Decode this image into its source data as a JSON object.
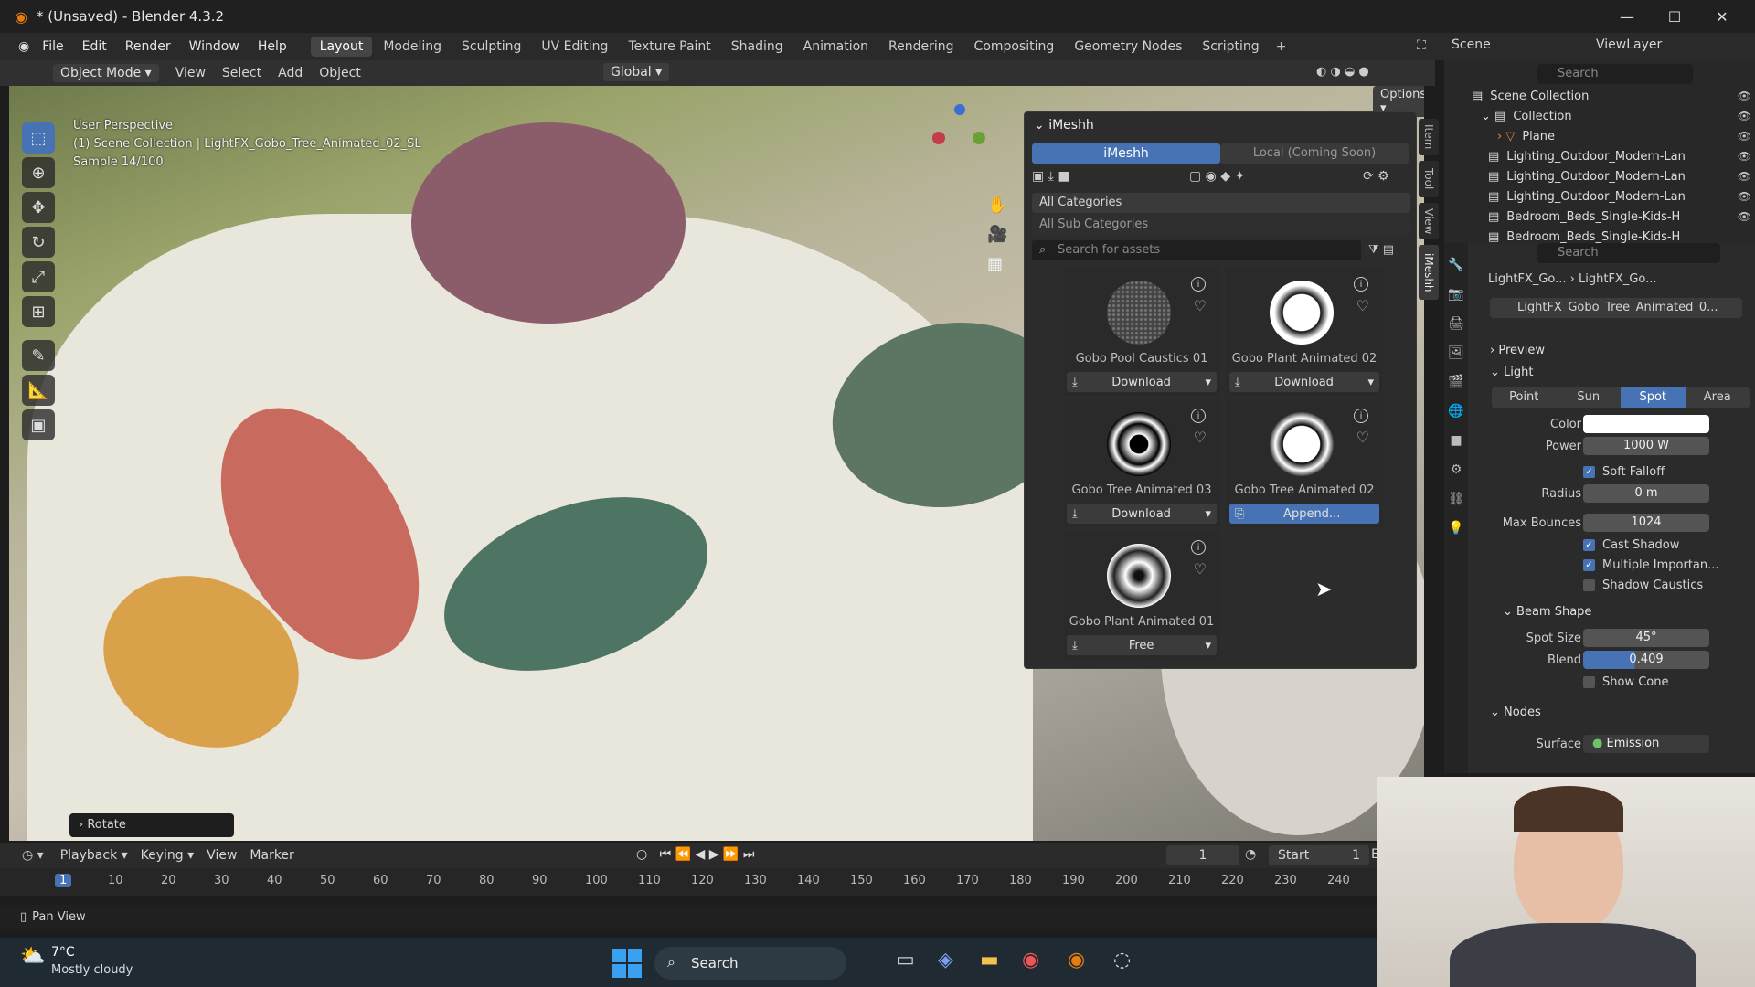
{
  "title": {
    "text": "* (Unsaved) - Blender 4.3.2"
  },
  "menu": {
    "items": [
      "File",
      "Edit",
      "Render",
      "Window",
      "Help"
    ],
    "workspaces": [
      "Layout",
      "Modeling",
      "Sculpting",
      "UV Editing",
      "Texture Paint",
      "Shading",
      "Animation",
      "Rendering",
      "Compositing",
      "Geometry Nodes",
      "Scripting"
    ],
    "active_workspace": "Layout",
    "scene": "Scene",
    "view_layer": "ViewLayer"
  },
  "viewport_header": {
    "mode": "Object Mode",
    "menus": [
      "View",
      "Select",
      "Add",
      "Object"
    ],
    "transform": "Global",
    "options": "Options"
  },
  "viewport": {
    "perspective": "User Perspective",
    "collection_path": "(1) Scene Collection | LightFX_Gobo_Tree_Animated_02_SL",
    "sample": "Sample 14/100",
    "operator_panel": "Rotate"
  },
  "side_tabs": [
    "Item",
    "Tool",
    "View",
    "iMeshh"
  ],
  "imeshh": {
    "title": "iMeshh",
    "tab_active": "iMeshh",
    "tab_other": "Local (Coming Soon)",
    "category": "All Categories",
    "subcategory": "All Sub Categories",
    "search_placeholder": "Search for assets",
    "assets": [
      {
        "name": "Gobo Pool Caustics 01",
        "button": "Download"
      },
      {
        "name": "Gobo Plant Animated 02",
        "button": "Download"
      },
      {
        "name": "Gobo Tree Animated 03",
        "button": "Download"
      },
      {
        "name": "Gobo Tree Animated 02",
        "button": "Append..."
      },
      {
        "name": "Gobo Plant Animated 01",
        "button": "Free"
      }
    ]
  },
  "outliner": {
    "search_placeholder": "Search",
    "items": [
      "Scene Collection",
      "Collection",
      "Plane",
      "Lighting_Outdoor_Modern-Lan",
      "Lighting_Outdoor_Modern-Lan",
      "Lighting_Outdoor_Modern-Lan",
      "Bedroom_Beds_Single-Kids-H",
      "Bedroom_Beds_Single-Kids-H"
    ]
  },
  "properties": {
    "search_placeholder": "Search",
    "breadcrumb_a": "LightFX_Go...",
    "breadcrumb_b": "LightFX_Go...",
    "datablock": "LightFX_Gobo_Tree_Animated_0...",
    "preview": "Preview",
    "light": "Light",
    "light_types": [
      "Point",
      "Sun",
      "Spot",
      "Area"
    ],
    "active_light_type": "Spot",
    "color_label": "Color",
    "color_value": "#ffffff",
    "power_label": "Power",
    "power": "1000 W",
    "soft_falloff": "Soft Falloff",
    "radius_label": "Radius",
    "radius": "0 m",
    "max_bounces_label": "Max Bounces",
    "max_bounces": "1024",
    "cast_shadow": "Cast Shadow",
    "multiple_importance": "Multiple Importan...",
    "shadow_caustics": "Shadow Caustics",
    "beam_shape": "Beam Shape",
    "spot_size_label": "Spot Size",
    "spot_size": "45°",
    "blend_label": "Blend",
    "blend": "0.409",
    "show_cone": "Show Cone",
    "nodes": "Nodes",
    "surface_label": "Surface",
    "surface": "Emission"
  },
  "timeline": {
    "menus": [
      "Playback",
      "Keying",
      "View",
      "Marker"
    ],
    "current_frame": "1",
    "start_label": "Start",
    "start": "1",
    "end_label": "E",
    "ticks": [
      "1",
      "10",
      "20",
      "30",
      "40",
      "50",
      "60",
      "70",
      "80",
      "90",
      "100",
      "110",
      "120",
      "130",
      "140",
      "150",
      "160",
      "170",
      "180",
      "190",
      "200",
      "210",
      "220",
      "230",
      "240"
    ]
  },
  "status": {
    "hint": "Pan View"
  },
  "taskbar": {
    "temperature": "7°C",
    "weather": "Mostly cloudy",
    "search": "Search"
  }
}
